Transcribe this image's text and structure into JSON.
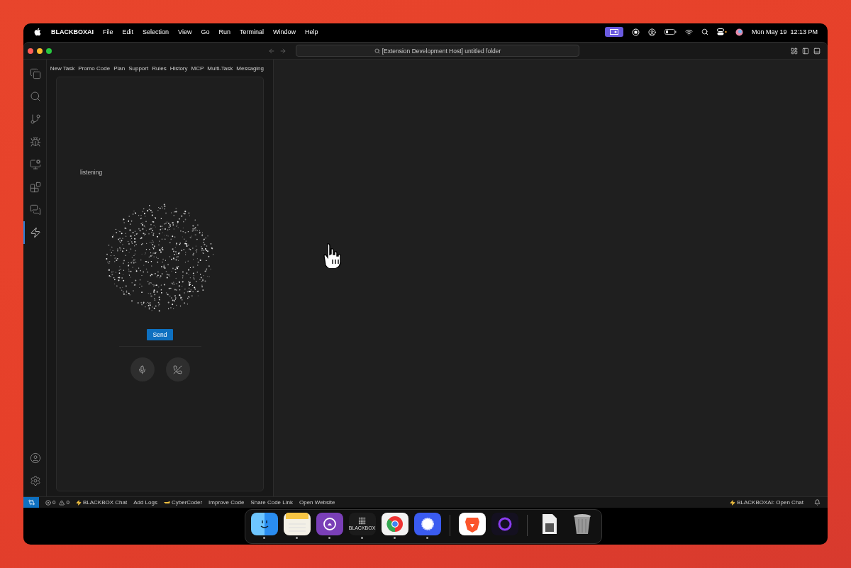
{
  "menu_bar": {
    "app_name": "BLACKBOXAI",
    "menus": [
      "File",
      "Edit",
      "Selection",
      "View",
      "Go",
      "Run",
      "Terminal",
      "Window",
      "Help"
    ],
    "clock": "Mon May 19  12:13 PM"
  },
  "title_bar": {
    "search": "[Extension Development Host] untitled folder"
  },
  "activity_bar": {
    "top": [
      {
        "kind": "files",
        "selected": false
      },
      {
        "kind": "search",
        "selected": false
      },
      {
        "kind": "source-control",
        "selected": false
      },
      {
        "kind": "run-debug",
        "selected": false
      },
      {
        "kind": "remote",
        "selected": false
      },
      {
        "kind": "extensions",
        "selected": false
      },
      {
        "kind": "chat",
        "selected": false
      },
      {
        "kind": "bolt",
        "selected": true
      }
    ],
    "bottom": [
      {
        "kind": "account"
      },
      {
        "kind": "settings"
      }
    ]
  },
  "sidebar": {
    "tabs": [
      "New Task",
      "Promo Code",
      "Plan",
      "Support",
      "Rules",
      "History",
      "MCP",
      "Multi-Task",
      "Messaging"
    ],
    "status": "listening",
    "send_button": "Send"
  },
  "status_bar": {
    "errors": "0",
    "warnings": "0",
    "items": [
      {
        "kind": "bolt",
        "label": "BLACKBOX Chat"
      },
      {
        "kind": "plain",
        "label": "Add Logs"
      },
      {
        "kind": "hand",
        "label": "CyberCoder"
      },
      {
        "kind": "plain",
        "label": "Improve Code"
      },
      {
        "kind": "plain",
        "label": "Share Code Link"
      },
      {
        "kind": "plain",
        "label": "Open Website"
      }
    ],
    "right": {
      "kind": "bolt",
      "label": "BLACKBOXAI: Open Chat"
    }
  },
  "dock": {
    "groups": [
      [
        {
          "kind": "face",
          "running": true
        },
        {
          "kind": "notes",
          "running": true
        },
        {
          "kind": "cat",
          "running": true
        },
        {
          "kind": "dots",
          "running": true,
          "label": "BLACKBOX"
        },
        {
          "kind": "wheel",
          "running": true
        },
        {
          "kind": "bubble",
          "running": true
        }
      ],
      [
        {
          "kind": "lion",
          "running": false
        },
        {
          "kind": "ring",
          "running": false
        }
      ],
      [
        {
          "kind": "file",
          "running": false
        },
        {
          "kind": "trash",
          "running": false
        }
      ]
    ]
  }
}
